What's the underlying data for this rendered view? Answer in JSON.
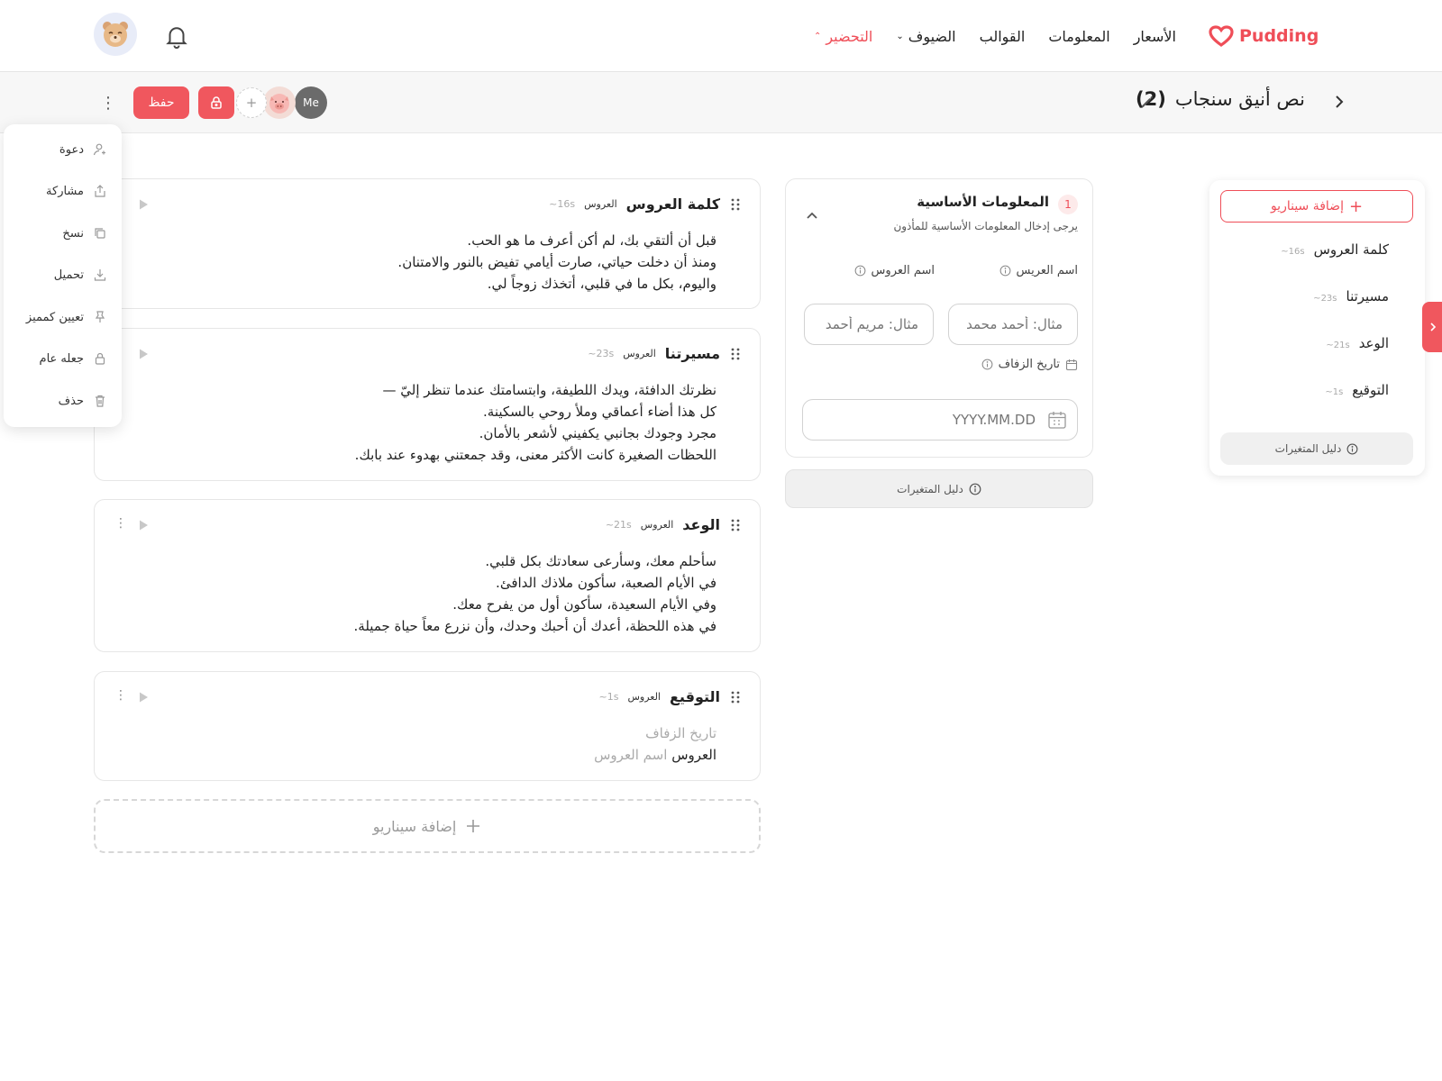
{
  "header": {
    "logo_text": "Pudding",
    "nav": [
      {
        "label": "التحضير",
        "active": true
      },
      {
        "label": "الضيوف",
        "active": false
      },
      {
        "label": "القوالب",
        "active": false
      },
      {
        "label": "المعلومات",
        "active": false
      },
      {
        "label": "الأسعار",
        "active": false
      }
    ]
  },
  "subheader": {
    "title": "نص أنيق سنجاب",
    "count": "(2)",
    "me_label": "Me",
    "save_label": "حفظ"
  },
  "menu": {
    "items": [
      "دعوة",
      "مشاركة",
      "نسخ",
      "تحميل",
      "تعيين كمميز",
      "جعله عام",
      "حذف"
    ]
  },
  "scenarios": [
    {
      "title": "كلمة العروس",
      "role": "العروس",
      "duration": "16s~",
      "lines": [
        "قبل أن ألتقي بك، لم أكن أعرف ما هو الحب.",
        "ومنذ أن دخلت حياتي، صارت أيامي تفيض بالنور والامتنان.",
        "واليوم، بكل ما في قلبي، أتخذك زوجاً لي."
      ]
    },
    {
      "title": "مسيرتنا",
      "role": "العروس",
      "duration": "23s~",
      "lines": [
        "نظرتك الدافئة، ويدك اللطيفة، وابتسامتك عندما تنظر إليّ —",
        "كل هذا أضاء أعماقي وملأ روحي بالسكينة.",
        "مجرد وجودك بجانبي يكفيني لأشعر بالأمان.",
        "اللحظات الصغيرة كانت الأكثر معنى، وقد جمعتني بهدوء عند بابك."
      ]
    },
    {
      "title": "الوعد",
      "role": "العروس",
      "duration": "21s~",
      "lines": [
        "سأحلم معك، وسأرعى سعادتك بكل قلبي.",
        "في الأيام الصعبة، سأكون ملاذك الدافئ.",
        "وفي الأيام السعيدة، سأكون أول من يفرح معك.",
        "في هذه اللحظة، أعدك أن أحبك وحدك، وأن نزرع معاً حياة جميلة."
      ]
    },
    {
      "title": "التوقيع",
      "role": "العروس",
      "duration": "1s~",
      "sig_date": "تاريخ الزفاف",
      "sig_role": "العروس",
      "sig_name": "اسم العروس"
    }
  ],
  "add_scenario_label": "إضافة سيناريو",
  "info_panel": {
    "number": "1",
    "title": "المعلومات الأساسية",
    "subtitle": "يرجى إدخال المعلومات الأساسية للمأذون",
    "groom_label": "اسم العريس",
    "bride_label": "اسم العروس",
    "groom_placeholder": "مثال: أحمد محمد",
    "bride_placeholder": "مثال: مريم أحمد",
    "date_label": "تاريخ الزفاف",
    "date_placeholder": "YYYY.MM.DD",
    "guide_label": "دليل المتغيرات"
  },
  "scenario_list": {
    "add_label": "إضافة سيناريو",
    "items": [
      {
        "title": "كلمة العروس",
        "duration": "16s~"
      },
      {
        "title": "مسيرتنا",
        "duration": "23s~"
      },
      {
        "title": "الوعد",
        "duration": "21s~"
      },
      {
        "title": "التوقيع",
        "duration": "1s~"
      }
    ],
    "guide_label": "دليل المتغيرات"
  },
  "colors": {
    "accent": "#ef4e58",
    "border": "#e6e6e6",
    "muted": "#aaaaaa"
  }
}
